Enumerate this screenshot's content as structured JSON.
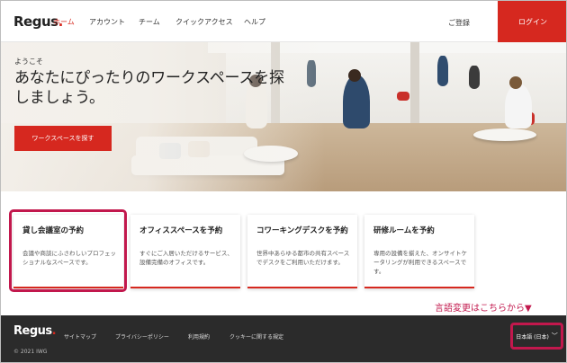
{
  "brand": {
    "logo_text": "Regus",
    "accent_color": "#d6281f",
    "annotation_color": "#c2184d"
  },
  "nav": {
    "items": [
      {
        "label": "ホーム",
        "active": true
      },
      {
        "label": "アカウント",
        "active": false
      },
      {
        "label": "チーム",
        "active": false
      },
      {
        "label": "クイックアクセス",
        "active": false
      },
      {
        "label": "ヘルプ",
        "active": false
      }
    ],
    "signup_label": "ご登録",
    "login_label": "ログイン"
  },
  "hero": {
    "welcome": "ようこそ",
    "headline": "あなたにぴったりのワークスペースを探しましょう。",
    "cta_label": "ワークスペースを探す"
  },
  "cards": [
    {
      "title": "貸し会議室の予約",
      "description": "会議や商談にふさわしいプロフェッショナルなスペースです。"
    },
    {
      "title": "オフィススペースを予約",
      "description": "すぐにご入居いただけるサービス、設備完備のオフィスです。"
    },
    {
      "title": "コワーキングデスクを予約",
      "description": "世界中あらゆる都市の共有スペースでデスクをご利用いただけます。"
    },
    {
      "title": "研修ルームを予約",
      "description": "専用の設備を揃えた、オンサイトケータリングが利用できるスペースです。"
    }
  ],
  "annotation": "言語変更はこちらから▼",
  "footer": {
    "logo_text": "Regus",
    "links": [
      "サイトマップ",
      "プライバシーポリシー",
      "利用規約",
      "クッキーに関する規定"
    ],
    "copyright": "© 2021 IWG",
    "language_label": "日本語 (日本)",
    "language_icon": "chevron-down-icon"
  }
}
